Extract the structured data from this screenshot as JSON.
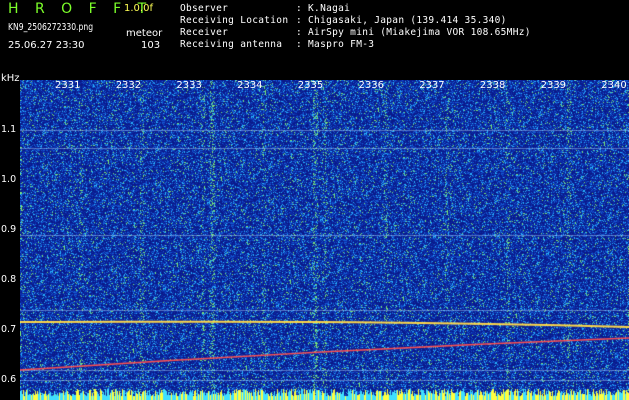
{
  "header": {
    "title": "H R O F F T",
    "version": "1.0.0f",
    "file": "KN9_2506272330.png",
    "mode": "meteor",
    "datetime": "25.06.27 23:30",
    "count": "103",
    "meta": [
      {
        "label": "Observer",
        "value": ": K.Nagai"
      },
      {
        "label": "Receiving Location",
        "value": ": Chigasaki, Japan (139.414 35.340)"
      },
      {
        "label": "Receiver",
        "value": ": AirSpy mini (Miakejima VOR 108.65MHz)"
      },
      {
        "label": "Receiving antenna",
        "value": ": Maspro FM-3"
      }
    ]
  },
  "spectrogram": {
    "y_unit": "kHz",
    "x_ticks": [
      "2331",
      "2332",
      "2333",
      "2334",
      "2335",
      "2336",
      "2337",
      "2338",
      "2339",
      "2340"
    ],
    "y_ticks": [
      "1.1",
      "1.0",
      "0.9",
      "0.8",
      "0.7",
      "0.6"
    ],
    "colors": {
      "background": "#0a1a8a",
      "noise": "#2aa0ff",
      "line": "#ffee33",
      "trace": "#ff4040"
    }
  }
}
